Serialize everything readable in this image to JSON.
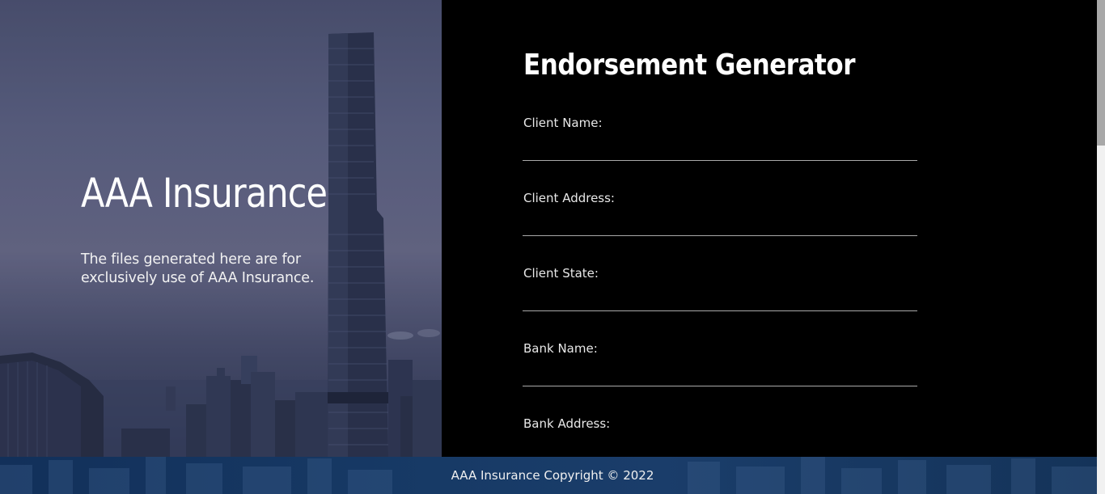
{
  "hero": {
    "title": "AAA Insurance",
    "subtitle": "The files generated here are for exclusively use of AAA Insurance."
  },
  "form": {
    "title": "Endorsement Generator",
    "fields": [
      {
        "label": "Client Name:",
        "value": ""
      },
      {
        "label": "Client Address:",
        "value": ""
      },
      {
        "label": "Client State:",
        "value": ""
      },
      {
        "label": "Bank Name:",
        "value": ""
      },
      {
        "label": "Bank Address:",
        "value": ""
      }
    ]
  },
  "footer": {
    "text": "AAA Insurance Copyright © 2022"
  },
  "colors": {
    "panel_background": "#000000",
    "footer_background": "#173a66",
    "hero_overlay": "#5d6282"
  }
}
